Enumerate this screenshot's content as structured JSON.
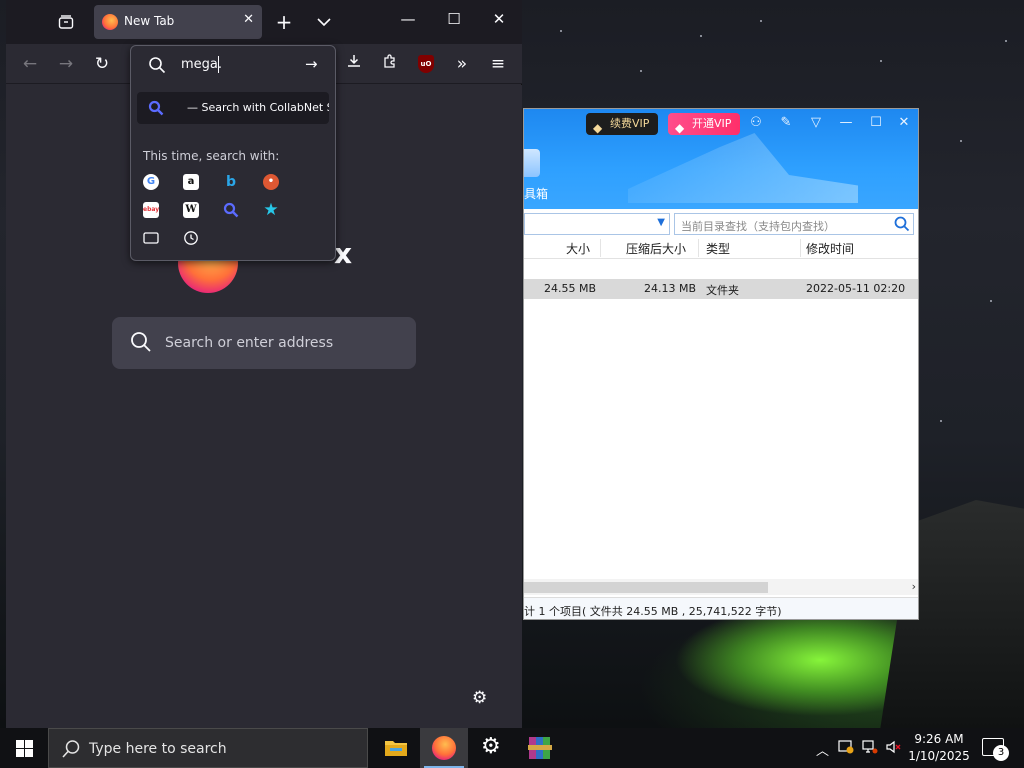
{
  "firefox": {
    "tab_title": "New Tab",
    "url_text": "mega.",
    "suggestion_text": "— Search with CollabNet Search",
    "one_time_label": "This time, search with:",
    "engines": [
      "google-icon",
      "amazon-icon",
      "bing-icon",
      "duckduckgo-icon",
      "ebay-icon",
      "wikipedia-icon",
      "collabnet-search-icon",
      "bookmarks-star-icon",
      "tabs-icon",
      "history-icon"
    ],
    "wordmark": "x",
    "newtab_search_placeholder": "Search or enter address"
  },
  "rar": {
    "vip_renew": "续费VIP",
    "vip_open": "开通VIP",
    "toolbox_label": "具箱",
    "find_placeholder": "当前目录查找（支持包内查找）",
    "columns": [
      "大小",
      "压缩后大小",
      "类型",
      "修改时间"
    ],
    "row": {
      "size": "24.55 MB",
      "packed": "24.13 MB",
      "type": "文件夹",
      "modified": "2022-05-11 02:20"
    },
    "status": "计 1 个项目( 文件共 24.55 MB , 25,741,522 字节)"
  },
  "taskbar": {
    "search_placeholder": "Type here to search",
    "time": "9:26 AM",
    "date": "1/10/2025",
    "notification_count": "3"
  },
  "colors": {
    "firefox_bg": "#2b2a33",
    "rar_blue": "#1e88f0",
    "vip_pink": "#ff2f6a"
  }
}
